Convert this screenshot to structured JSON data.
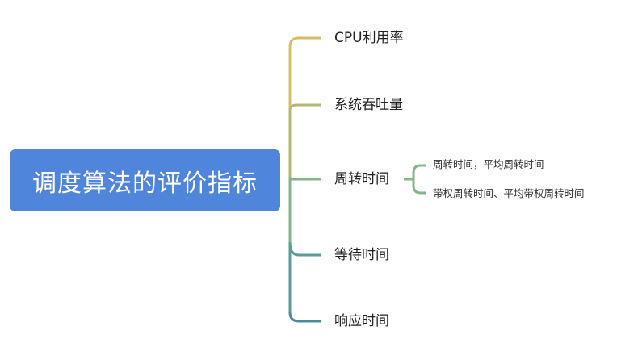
{
  "root": {
    "label": "调度算法的评价指标",
    "color": "#4f86db"
  },
  "branches": [
    {
      "label": "CPU利用率",
      "color": "#d6bd6a"
    },
    {
      "label": "系统吞吐量",
      "color": "#b2b873"
    },
    {
      "label": "周转时间",
      "color": "#86b58a",
      "children": [
        {
          "label": "周转时间，平均周转时间"
        },
        {
          "label": "带权周转时间、平均带权周转时间"
        }
      ]
    },
    {
      "label": "等待时间",
      "color": "#5a9d96"
    },
    {
      "label": "响应时间",
      "color": "#4a8a9c"
    }
  ]
}
